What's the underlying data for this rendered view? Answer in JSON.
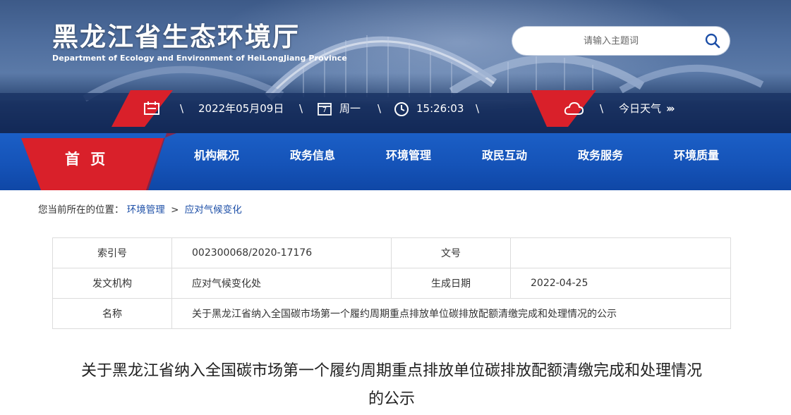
{
  "header": {
    "site_title": "黑龙江省生态环境厅",
    "site_subtitle": "Department of Ecology and Environment of HeiLongJiang Province",
    "search_placeholder": "请输入主题词"
  },
  "info_bar": {
    "date": "2022年05月09日",
    "calendar_day": "7",
    "weekday": "周一",
    "time": "15:26:03",
    "weather_label": "今日天气",
    "weather_more": "›››",
    "separator": "\\"
  },
  "nav": {
    "home": "首 页",
    "items": [
      "机构概况",
      "政务信息",
      "环境管理",
      "政民互动",
      "政务服务",
      "环境质量"
    ]
  },
  "breadcrumb": {
    "prefix": "您当前所在的位置：",
    "items": [
      "环境管理",
      "应对气候变化"
    ],
    "separator": ">"
  },
  "meta_table": {
    "index_label": "索引号",
    "index_value": "002300068/2020-17176",
    "doc_no_label": "文号",
    "doc_no_value": "",
    "issuer_label": "发文机构",
    "issuer_value": "应对气候变化处",
    "date_label": "生成日期",
    "date_value": "2022-04-25",
    "name_label": "名称",
    "name_value": "关于黑龙江省纳入全国碳市场第一个履约周期重点排放单位碳排放配额清缴完成和处理情况的公示"
  },
  "article": {
    "title_line1": "关于黑龙江省纳入全国碳市场第一个履约周期重点排放单位碳排放配额清缴完成和处理情况",
    "title_line2": "的公示"
  },
  "colors": {
    "nav_blue": "#1553b8",
    "accent_red": "#d9202a",
    "link_blue": "#1d4fa7"
  }
}
